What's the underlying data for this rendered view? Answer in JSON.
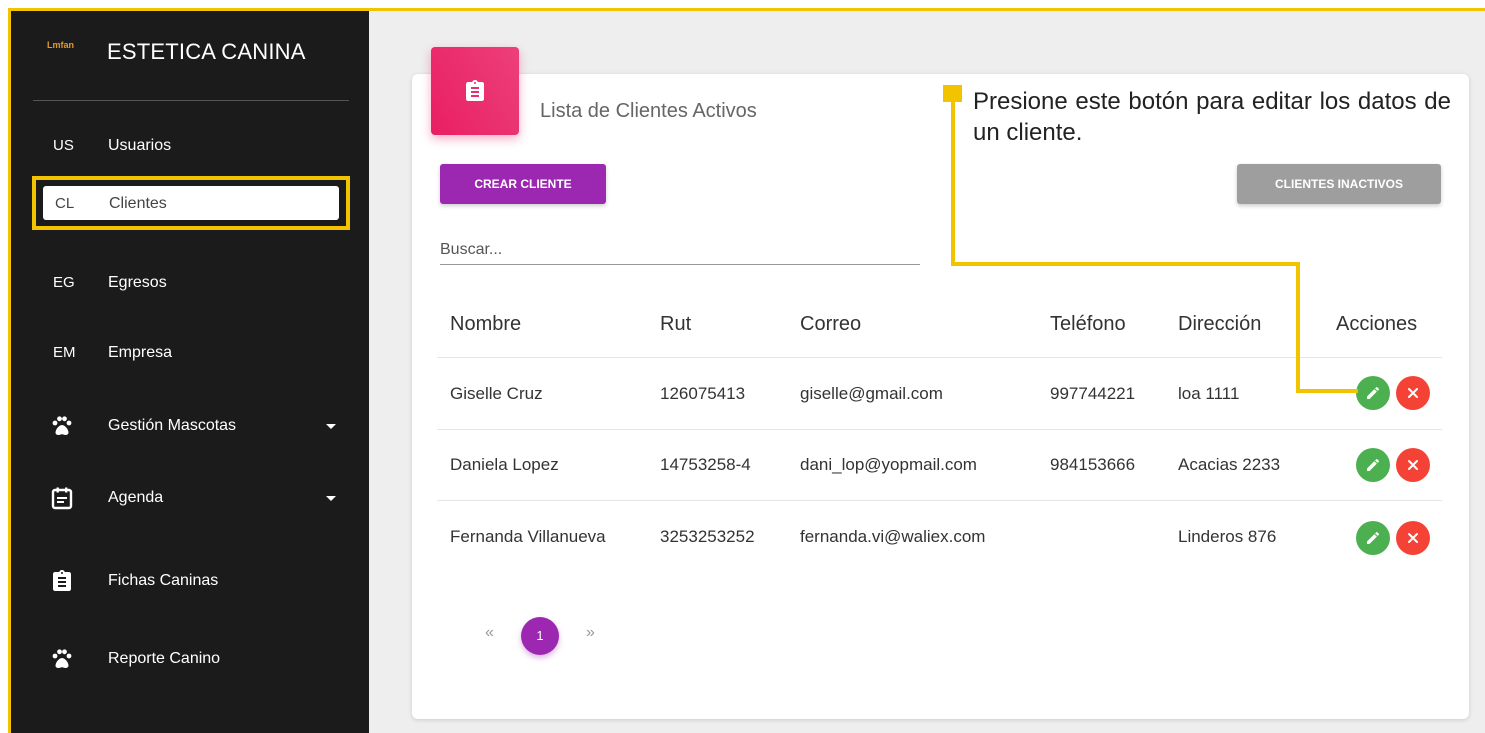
{
  "brand": {
    "logo": "Lmfan",
    "title": "ESTETICA CANINA"
  },
  "sidebar": {
    "items": [
      {
        "abbr": "US",
        "label": "Usuarios"
      },
      {
        "abbr": "CL",
        "label": "Clientes",
        "active": true
      },
      {
        "abbr": "EG",
        "label": "Egresos"
      },
      {
        "abbr": "EM",
        "label": "Empresa"
      },
      {
        "icon": "paw-icon",
        "label": "Gestión Mascotas",
        "dropdown": true
      },
      {
        "icon": "calendar-icon",
        "label": "Agenda",
        "dropdown": true
      },
      {
        "icon": "clipboard-icon",
        "label": "Fichas Caninas"
      },
      {
        "icon": "paw-icon",
        "label": "Reporte Canino"
      }
    ]
  },
  "card": {
    "icon": "clipboard-icon",
    "title": "Lista de Clientes Activos",
    "create_button": "CREAR CLIENTE",
    "inactive_button": "CLIENTES INACTIVOS",
    "search_placeholder": "Buscar..."
  },
  "table": {
    "headers": [
      "Nombre",
      "Rut",
      "Correo",
      "Teléfono",
      "Dirección",
      "Acciones"
    ],
    "rows": [
      [
        "Giselle Cruz",
        "126075413",
        "giselle@gmail.com",
        "997744221",
        "loa 1111"
      ],
      [
        "Daniela Lopez",
        "14753258-4",
        "dani_lop@yopmail.com",
        "984153666",
        "Acacias 2233"
      ],
      [
        "Fernanda Villanueva",
        "3253253252",
        "fernanda.vi@waliex.com",
        "",
        "Linderos 876"
      ]
    ],
    "action_icons": [
      "pencil-icon",
      "close-icon"
    ]
  },
  "pagination": {
    "prev": "«",
    "current": "1",
    "next": "»"
  },
  "callout": {
    "text": "Presione este botón para editar los datos de un cliente."
  },
  "colors": {
    "accent": "#9c27b0",
    "card_icon": "#e91e63",
    "highlight": "#f2c400",
    "edit": "#4caf50",
    "delete": "#f44336",
    "sidebar": "#1b1b1b"
  }
}
